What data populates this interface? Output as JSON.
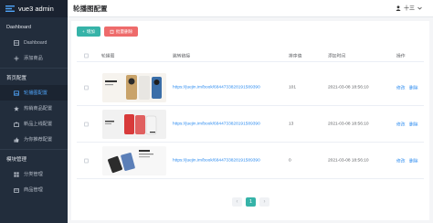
{
  "brand": {
    "title": "vue3 admin"
  },
  "sidebar": {
    "groups": [
      {
        "label": "Dashboard",
        "items": [
          {
            "label": "Dashboard",
            "icon": "dashboard-icon"
          },
          {
            "label": "添加商品",
            "icon": "add-icon"
          }
        ]
      },
      {
        "label": "首页配置",
        "items": [
          {
            "label": "轮播图配置",
            "icon": "picture-icon",
            "active": true
          },
          {
            "label": "热销商品配置",
            "icon": "star-icon"
          },
          {
            "label": "新品上线配置",
            "icon": "sell-icon"
          },
          {
            "label": "为你推荐配置",
            "icon": "thumb-icon"
          }
        ]
      },
      {
        "label": "模块管理",
        "items": [
          {
            "label": "分类管理",
            "icon": "menu-icon"
          },
          {
            "label": "商品管理",
            "icon": "goods-icon"
          }
        ]
      }
    ]
  },
  "header": {
    "title": "轮播图配置",
    "user": "十三"
  },
  "toolbar": {
    "add_label": "增加",
    "batch_delete_label": "批量删除"
  },
  "table": {
    "columns": [
      "轮播图",
      "跳转链接",
      "排序值",
      "添加时间",
      "操作"
    ],
    "rows": [
      {
        "link": "https://juejin.im/book/6844733828191589390",
        "order": "101",
        "time": "2021-03-08 18:56:10",
        "edit": "修改",
        "delete": "删除"
      },
      {
        "link": "https://juejin.im/book/6844733828191589390",
        "order": "13",
        "time": "2021-03-08 18:56:10",
        "edit": "修改",
        "delete": "删除"
      },
      {
        "link": "https://juejin.im/book/6844733828191589390",
        "order": "0",
        "time": "2021-03-08 18:56:10",
        "edit": "修改",
        "delete": "删除"
      }
    ]
  },
  "pagination": {
    "prev": "‹",
    "current": "1",
    "next": "›"
  },
  "colors": {
    "primary": "#36b3a8",
    "danger": "#ee6b6b",
    "link": "#2d8cf0",
    "sidebar": "#222d3c"
  }
}
